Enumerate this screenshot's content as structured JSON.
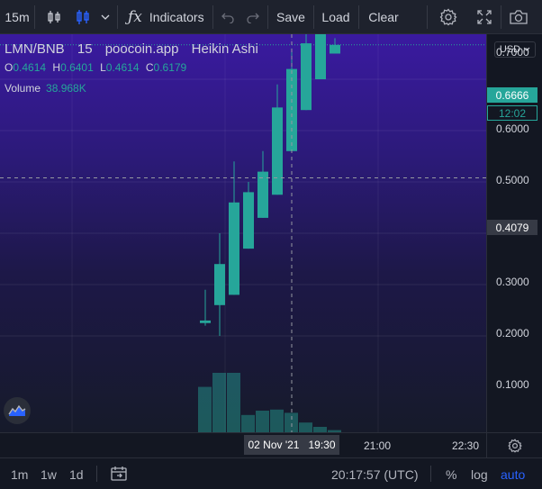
{
  "toolbar": {
    "interval": "15m",
    "indicators_label": "Indicators",
    "save_label": "Save",
    "load_label": "Load",
    "clear_label": "Clear",
    "icons": [
      "bar-style-icon",
      "candle-style-icon",
      "chevron-down-icon",
      "function-icon",
      "undo-icon",
      "redo-icon",
      "gear-icon",
      "fullscreen-icon",
      "camera-icon"
    ]
  },
  "legend": {
    "symbol": "LMN/BNB",
    "interval": "15",
    "source": "poocoin.app",
    "chart_style": "Heikin Ashi",
    "o_label": "O",
    "o_value": "0.4614",
    "h_label": "H",
    "h_value": "0.6401",
    "l_label": "L",
    "l_value": "0.4614",
    "c_label": "C",
    "c_value": "0.6179",
    "volume_label": "Volume",
    "volume_value": "38.968K"
  },
  "price_axis": {
    "currency": "USD",
    "ticks": [
      "0.7000",
      "0.6000",
      "0.5000",
      "0.3000",
      "0.2000",
      "0.1000"
    ],
    "last_price": "0.6666",
    "countdown": "12:02",
    "crosshair_price": "0.4079"
  },
  "time_axis": {
    "crosshair_label": "02 Nov '21   19:30",
    "ticks": [
      "21:00",
      "22:30"
    ]
  },
  "bottom_bar": {
    "ranges": [
      "1m",
      "1w",
      "1d"
    ],
    "clock": "20:17:57 (UTC)",
    "percent_label": "%",
    "log_label": "log",
    "auto_label": "auto"
  },
  "colors": {
    "up": "#26a69a",
    "accent": "#2962ff",
    "background_top": "#3a1aa0",
    "background_bottom": "#161a2a"
  },
  "chart_data": {
    "type": "candlestick",
    "style": "Heikin Ashi",
    "y_range": [
      0,
      0.75
    ],
    "candles": [
      {
        "o": 0.125,
        "h": 0.19,
        "l": 0.12,
        "c": 0.13
      },
      {
        "o": 0.16,
        "h": 0.3,
        "l": 0.1,
        "c": 0.24
      },
      {
        "o": 0.18,
        "h": 0.44,
        "l": 0.18,
        "c": 0.36
      },
      {
        "o": 0.27,
        "h": 0.4,
        "l": 0.27,
        "c": 0.38
      },
      {
        "o": 0.33,
        "h": 0.46,
        "l": 0.33,
        "c": 0.42
      },
      {
        "o": 0.375,
        "h": 0.59,
        "l": 0.375,
        "c": 0.545
      },
      {
        "o": 0.46,
        "h": 0.66,
        "l": 0.46,
        "c": 0.62
      },
      {
        "o": 0.54,
        "h": 0.69,
        "l": 0.54,
        "c": 0.67
      },
      {
        "o": 0.6,
        "h": 0.705,
        "l": 0.6,
        "c": 0.695
      },
      {
        "o": 0.65,
        "h": 0.68,
        "l": 0.65,
        "c": 0.667
      }
    ],
    "volume": [
      0.42,
      0.55,
      0.55,
      0.16,
      0.2,
      0.21,
      0.18,
      0.09,
      0.05,
      0.02
    ]
  }
}
